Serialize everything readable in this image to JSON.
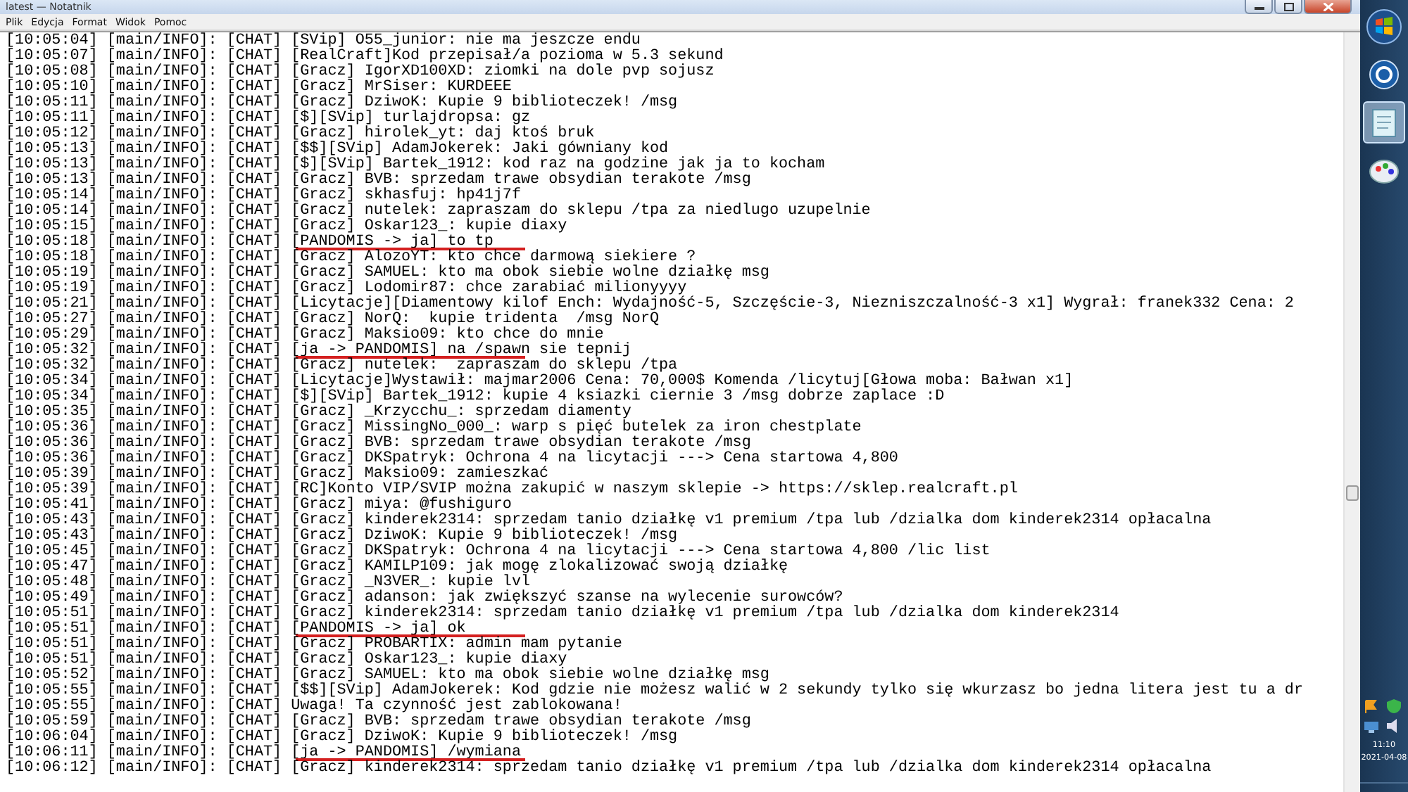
{
  "window": {
    "title": "latest — Notatnik"
  },
  "menu": [
    {
      "label": "Plik"
    },
    {
      "label": "Edycja"
    },
    {
      "label": "Format"
    },
    {
      "label": "Widok"
    },
    {
      "label": "Pomoc"
    }
  ],
  "log": [
    {
      "text": "[10:05:04] [main/INFO]: [CHAT] [SVip] O55_junior: nie ma jeszcze endu",
      "underlined": false
    },
    {
      "text": "[10:05:07] [main/INFO]: [CHAT] [RealCraft]Kod przepisał/a pozioma w 5.3 sekund",
      "underlined": false
    },
    {
      "text": "[10:05:08] [main/INFO]: [CHAT] [Gracz] IgorXD100XD: ziomki na dole pvp sojusz",
      "underlined": false
    },
    {
      "text": "[10:05:10] [main/INFO]: [CHAT] [Gracz] MrSiser: KURDEEE",
      "underlined": false
    },
    {
      "text": "[10:05:11] [main/INFO]: [CHAT] [Gracz] DziwoK: Kupie 9 biblioteczek! /msg",
      "underlined": false
    },
    {
      "text": "[10:05:11] [main/INFO]: [CHAT] [$][SVip] turlajdropsa: gz",
      "underlined": false
    },
    {
      "text": "[10:05:12] [main/INFO]: [CHAT] [Gracz] hirolek_yt: daj ktoś bruk",
      "underlined": false
    },
    {
      "text": "[10:05:13] [main/INFO]: [CHAT] [$$][SVip] AdamJokerek: Jaki gówniany kod",
      "underlined": false
    },
    {
      "text": "[10:05:13] [main/INFO]: [CHAT] [$][SVip] Bartek_1912: kod raz na godzine jak ja to kocham",
      "underlined": false
    },
    {
      "text": "[10:05:13] [main/INFO]: [CHAT] [Gracz] BVB: sprzedam trawe obsydian terakote /msg",
      "underlined": false
    },
    {
      "text": "[10:05:14] [main/INFO]: [CHAT] [Gracz] skhasfuj: hp41j7f",
      "underlined": false
    },
    {
      "text": "[10:05:14] [main/INFO]: [CHAT] [Gracz] nutelek: zapraszam do sklepu /tpa za niedlugo uzupelnie",
      "underlined": false
    },
    {
      "text": "[10:05:15] [main/INFO]: [CHAT] [Gracz] Oskar123_: kupie diaxy",
      "underlined": false
    },
    {
      "text": "[10:05:18] [main/INFO]: [CHAT] [PANDOMIS -> ja] to tp",
      "underlined": true
    },
    {
      "text": "[10:05:18] [main/INFO]: [CHAT] [Gracz] AlozoYT: kto chce darmową siekiere ?",
      "underlined": false
    },
    {
      "text": "[10:05:19] [main/INFO]: [CHAT] [Gracz] SAMUEL: kto ma obok siebie wolne działkę msg",
      "underlined": false
    },
    {
      "text": "[10:05:19] [main/INFO]: [CHAT] [Gracz] Lodomir87: chce zarabiać milionyyyy",
      "underlined": false
    },
    {
      "text": "[10:05:21] [main/INFO]: [CHAT] [Licytacje][Diamentowy kilof Ench: Wydajność-5, Szczęście-3, Niezniszczalność-3 x1] Wygrał: franek332 Cena: 2",
      "underlined": false
    },
    {
      "text": "[10:05:27] [main/INFO]: [CHAT] [Gracz] NorQ:  kupie tridenta  /msg NorQ",
      "underlined": false
    },
    {
      "text": "[10:05:29] [main/INFO]: [CHAT] [Gracz] Maksio09: kto chce do mnie",
      "underlined": false
    },
    {
      "text": "[10:05:32] [main/INFO]: [CHAT] [ja -> PANDOMIS] na /spawn sie tepnij",
      "underlined": true
    },
    {
      "text": "[10:05:32] [main/INFO]: [CHAT] [Gracz] nutelek:  zapraszam do sklepu /tpa",
      "underlined": false
    },
    {
      "text": "[10:05:34] [main/INFO]: [CHAT] [Licytacje]Wystawił: majmar2006 Cena: 70,000$ Komenda /licytuj[Głowa moba: Bałwan x1]",
      "underlined": false
    },
    {
      "text": "[10:05:34] [main/INFO]: [CHAT] [$][SVip] Bartek_1912: kupie 4 ksiazki ciernie 3 /msg dobrze zaplace :D",
      "underlined": false
    },
    {
      "text": "[10:05:35] [main/INFO]: [CHAT] [Gracz] _Krzycchu_: sprzedam diamenty",
      "underlined": false
    },
    {
      "text": "[10:05:36] [main/INFO]: [CHAT] [Gracz] MissingNo_000_: warp s pięć butelek za iron chestplate",
      "underlined": false
    },
    {
      "text": "[10:05:36] [main/INFO]: [CHAT] [Gracz] BVB: sprzedam trawe obsydian terakote /msg",
      "underlined": false
    },
    {
      "text": "[10:05:36] [main/INFO]: [CHAT] [Gracz] DKSpatryk: Ochrona 4 na licytacji ---> Cena startowa 4,800",
      "underlined": false
    },
    {
      "text": "[10:05:39] [main/INFO]: [CHAT] [Gracz] Maksio09: zamieszkać",
      "underlined": false
    },
    {
      "text": "[10:05:39] [main/INFO]: [CHAT] [RC]Konto VIP/SVIP można zakupić w naszym sklepie -> https://sklep.realcraft.pl",
      "underlined": false
    },
    {
      "text": "[10:05:41] [main/INFO]: [CHAT] [Gracz] miya: @fushiguro",
      "underlined": false
    },
    {
      "text": "[10:05:43] [main/INFO]: [CHAT] [Gracz] kinderek2314: sprzedam tanio działkę v1 premium /tpa lub /dzialka dom kinderek2314 opłacalna",
      "underlined": false
    },
    {
      "text": "[10:05:43] [main/INFO]: [CHAT] [Gracz] DziwoK: Kupie 9 biblioteczek! /msg",
      "underlined": false
    },
    {
      "text": "[10:05:45] [main/INFO]: [CHAT] [Gracz] DKSpatryk: Ochrona 4 na licytacji ---> Cena startowa 4,800 /lic list",
      "underlined": false
    },
    {
      "text": "[10:05:47] [main/INFO]: [CHAT] [Gracz] KAMILP109: jak mogę zlokalizować swoją działkę",
      "underlined": false
    },
    {
      "text": "[10:05:48] [main/INFO]: [CHAT] [Gracz] _N3VER_: kupie lvl",
      "underlined": false
    },
    {
      "text": "[10:05:49] [main/INFO]: [CHAT] [Gracz] adanson: jak zwiększyć szanse na wylecenie surowców?",
      "underlined": false
    },
    {
      "text": "[10:05:51] [main/INFO]: [CHAT] [Gracz] kinderek2314: sprzedam tanio działkę v1 premium /tpa lub /dzialka dom kinderek2314",
      "underlined": false
    },
    {
      "text": "[10:05:51] [main/INFO]: [CHAT] [PANDOMIS -> ja] ok",
      "underlined": true
    },
    {
      "text": "[10:05:51] [main/INFO]: [CHAT] [Gracz] PROBARTIX: admin mam pytanie",
      "underlined": false
    },
    {
      "text": "[10:05:51] [main/INFO]: [CHAT] [Gracz] Oskar123_: kupie diaxy",
      "underlined": false
    },
    {
      "text": "[10:05:52] [main/INFO]: [CHAT] [Gracz] SAMUEL: kto ma obok siebie wolne działkę msg",
      "underlined": false
    },
    {
      "text": "[10:05:55] [main/INFO]: [CHAT] [$$][SVip] AdamJokerek: Kod gdzie nie możesz walić w 2 sekundy tylko się wkurzasz bo jedna litera jest tu a dr",
      "underlined": false
    },
    {
      "text": "[10:05:55] [main/INFO]: [CHAT] Uwaga! Ta czynność jest zablokowana!",
      "underlined": false
    },
    {
      "text": "[10:05:59] [main/INFO]: [CHAT] [Gracz] BVB: sprzedam trawe obsydian terakote /msg",
      "underlined": false
    },
    {
      "text": "[10:06:04] [main/INFO]: [CHAT] [Gracz] DziwoK: Kupie 9 biblioteczek! /msg",
      "underlined": false
    },
    {
      "text": "[10:06:11] [main/INFO]: [CHAT] [ja -> PANDOMIS] /wymiana",
      "underlined": true
    },
    {
      "text": "[10:06:12] [main/INFO]: [CHAT] [Gracz] kinderek2314: sprzedam tanio działkę v1 premium /tpa lub /dzialka dom kinderek2314 opłacalna",
      "underlined": false
    }
  ],
  "taskbar": {
    "apps": [
      {
        "kind": "start",
        "selected": false
      },
      {
        "kind": "media",
        "selected": false
      },
      {
        "kind": "notepad",
        "selected": true
      },
      {
        "kind": "paint",
        "selected": false
      }
    ],
    "time": "11:10",
    "date": "2021-04-08"
  }
}
